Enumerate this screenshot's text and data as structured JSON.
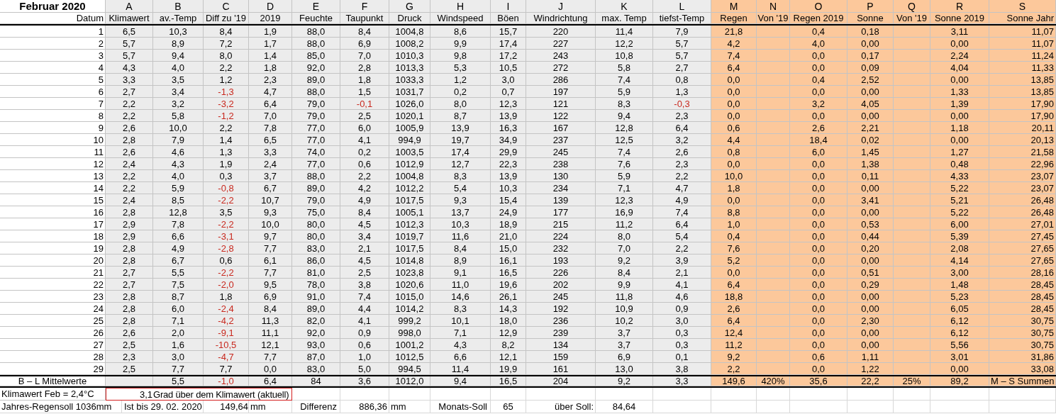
{
  "sheet": {
    "title": "Februar 2020",
    "column_letters": [
      "A",
      "B",
      "C",
      "D",
      "E",
      "F",
      "G",
      "H",
      "I",
      "J",
      "K",
      "L",
      "M",
      "N",
      "O",
      "P",
      "Q",
      "R",
      "S"
    ],
    "column_headers": [
      "Datum",
      "Klimawert",
      "av.-Temp",
      "Diff zu '19",
      "2019",
      "Feuchte",
      "Taupunkt",
      "Druck",
      "Windspeed",
      "Böen",
      "Windrichtung",
      "max. Temp",
      "tiefst-Temp",
      "Regen",
      "Von '19",
      "Regen 2019",
      "Sonne",
      "Von '19",
      "Sonne 2019",
      "Sonne Jahr"
    ],
    "rows": [
      [
        "1",
        "6,5",
        "10,3",
        "8,4",
        "1,9",
        "88,0",
        "8,4",
        "1004,8",
        "8,6",
        "15,7",
        "220",
        "11,4",
        "7,9",
        "21,8",
        null,
        "0,4",
        "0,18",
        null,
        "3,11",
        "11,07"
      ],
      [
        "2",
        "5,7",
        "8,9",
        "7,2",
        "1,7",
        "88,0",
        "6,9",
        "1008,2",
        "9,9",
        "17,4",
        "227",
        "12,2",
        "5,7",
        "4,2",
        null,
        "4,0",
        "0,00",
        null,
        "0,00",
        "11,07"
      ],
      [
        "3",
        "5,7",
        "9,4",
        "8,0",
        "1,4",
        "85,0",
        "7,0",
        "1010,3",
        "9,8",
        "17,2",
        "243",
        "10,8",
        "5,7",
        "7,4",
        null,
        "0,0",
        "0,17",
        null,
        "2,24",
        "11,24"
      ],
      [
        "4",
        "4,3",
        "4,0",
        "2,2",
        "1,8",
        "92,0",
        "2,8",
        "1013,3",
        "5,3",
        "10,5",
        "272",
        "5,8",
        "2,7",
        "6,4",
        null,
        "0,0",
        "0,09",
        null,
        "4,04",
        "11,33"
      ],
      [
        "5",
        "3,3",
        "3,5",
        "1,2",
        "2,3",
        "89,0",
        "1,8",
        "1033,3",
        "1,2",
        "3,0",
        "286",
        "7,4",
        "0,8",
        "0,0",
        null,
        "0,4",
        "2,52",
        null,
        "0,00",
        "13,85"
      ],
      [
        "6",
        "2,7",
        "3,4",
        "-1,3",
        "4,7",
        "88,0",
        "1,5",
        "1031,7",
        "0,2",
        "0,7",
        "197",
        "5,9",
        "1,3",
        "0,0",
        null,
        "0,0",
        "0,00",
        null,
        "1,33",
        "13,85"
      ],
      [
        "7",
        "2,2",
        "3,2",
        "-3,2",
        "6,4",
        "79,0",
        "-0,1",
        "1026,0",
        "8,0",
        "12,3",
        "121",
        "8,3",
        "-0,3",
        "0,0",
        null,
        "3,2",
        "4,05",
        null,
        "1,39",
        "17,90"
      ],
      [
        "8",
        "2,2",
        "5,8",
        "-1,2",
        "7,0",
        "79,0",
        "2,5",
        "1020,1",
        "8,7",
        "13,9",
        "122",
        "9,4",
        "2,3",
        "0,0",
        null,
        "0,0",
        "0,00",
        null,
        "0,00",
        "17,90"
      ],
      [
        "9",
        "2,6",
        "10,0",
        "2,2",
        "7,8",
        "77,0",
        "6,0",
        "1005,9",
        "13,9",
        "16,3",
        "167",
        "12,8",
        "6,4",
        "0,6",
        null,
        "2,6",
        "2,21",
        null,
        "1,18",
        "20,11"
      ],
      [
        "10",
        "2,8",
        "7,9",
        "1,4",
        "6,5",
        "77,0",
        "4,1",
        "994,9",
        "19,7",
        "34,9",
        "237",
        "12,5",
        "3,2",
        "4,4",
        null,
        "18,4",
        "0,02",
        null,
        "0,00",
        "20,13"
      ],
      [
        "11",
        "2,6",
        "4,6",
        "1,3",
        "3,3",
        "74,0",
        "0,2",
        "1003,5",
        "17,4",
        "29,9",
        "245",
        "7,4",
        "2,6",
        "0,8",
        null,
        "6,0",
        "1,45",
        null,
        "1,27",
        "21,58"
      ],
      [
        "12",
        "2,4",
        "4,3",
        "1,9",
        "2,4",
        "77,0",
        "0,6",
        "1012,9",
        "12,7",
        "22,3",
        "238",
        "7,6",
        "2,3",
        "0,0",
        null,
        "0,0",
        "1,38",
        null,
        "0,48",
        "22,96"
      ],
      [
        "13",
        "2,2",
        "4,0",
        "0,3",
        "3,7",
        "88,0",
        "2,2",
        "1004,8",
        "8,3",
        "13,9",
        "130",
        "5,9",
        "2,2",
        "10,0",
        null,
        "0,0",
        "0,11",
        null,
        "4,33",
        "23,07"
      ],
      [
        "14",
        "2,2",
        "5,9",
        "-0,8",
        "6,7",
        "89,0",
        "4,2",
        "1012,2",
        "5,4",
        "10,3",
        "234",
        "7,1",
        "4,7",
        "1,8",
        null,
        "0,0",
        "0,00",
        null,
        "5,22",
        "23,07"
      ],
      [
        "15",
        "2,4",
        "8,5",
        "-2,2",
        "10,7",
        "79,0",
        "4,9",
        "1017,5",
        "9,3",
        "15,4",
        "139",
        "12,3",
        "4,9",
        "0,0",
        null,
        "0,0",
        "3,41",
        null,
        "5,21",
        "26,48"
      ],
      [
        "16",
        "2,8",
        "12,8",
        "3,5",
        "9,3",
        "75,0",
        "8,4",
        "1005,1",
        "13,7",
        "24,9",
        "177",
        "16,9",
        "7,4",
        "8,8",
        null,
        "0,0",
        "0,00",
        null,
        "5,22",
        "26,48"
      ],
      [
        "17",
        "2,9",
        "7,8",
        "-2,2",
        "10,0",
        "80,0",
        "4,5",
        "1012,3",
        "10,3",
        "18,9",
        "215",
        "11,2",
        "6,4",
        "1,0",
        null,
        "0,0",
        "0,53",
        null,
        "6,00",
        "27,01"
      ],
      [
        "18",
        "2,9",
        "6,6",
        "-3,1",
        "9,7",
        "80,0",
        "3,4",
        "1019,7",
        "11,6",
        "21,0",
        "224",
        "8,0",
        "5,4",
        "0,4",
        null,
        "0,0",
        "0,44",
        null,
        "5,39",
        "27,45"
      ],
      [
        "19",
        "2,8",
        "4,9",
        "-2,8",
        "7,7",
        "83,0",
        "2,1",
        "1017,5",
        "8,4",
        "15,0",
        "232",
        "7,0",
        "2,2",
        "7,6",
        null,
        "0,0",
        "0,20",
        null,
        "2,08",
        "27,65"
      ],
      [
        "20",
        "2,8",
        "6,7",
        "0,6",
        "6,1",
        "86,0",
        "4,5",
        "1014,8",
        "8,9",
        "16,1",
        "193",
        "9,2",
        "3,9",
        "5,2",
        null,
        "0,0",
        "0,00",
        null,
        "4,14",
        "27,65"
      ],
      [
        "21",
        "2,7",
        "5,5",
        "-2,2",
        "7,7",
        "81,0",
        "2,5",
        "1023,8",
        "9,1",
        "16,5",
        "226",
        "8,4",
        "2,1",
        "0,0",
        null,
        "0,0",
        "0,51",
        null,
        "3,00",
        "28,16"
      ],
      [
        "22",
        "2,7",
        "7,5",
        "-2,0",
        "9,5",
        "78,0",
        "3,8",
        "1020,6",
        "11,0",
        "19,6",
        "202",
        "9,9",
        "4,1",
        "6,4",
        null,
        "0,0",
        "0,29",
        null,
        "1,48",
        "28,45"
      ],
      [
        "23",
        "2,8",
        "8,7",
        "1,8",
        "6,9",
        "91,0",
        "7,4",
        "1015,0",
        "14,6",
        "26,1",
        "245",
        "11,8",
        "4,6",
        "18,8",
        null,
        "0,0",
        "0,00",
        null,
        "5,23",
        "28,45"
      ],
      [
        "24",
        "2,8",
        "6,0",
        "-2,4",
        "8,4",
        "89,0",
        "4,4",
        "1014,2",
        "8,3",
        "14,3",
        "192",
        "10,9",
        "0,9",
        "2,6",
        null,
        "0,0",
        "0,00",
        null,
        "6,05",
        "28,45"
      ],
      [
        "25",
        "2,8",
        "7,1",
        "-4,2",
        "11,3",
        "82,0",
        "4,1",
        "999,2",
        "10,1",
        "18,0",
        "236",
        "10,2",
        "3,0",
        "6,4",
        null,
        "0,0",
        "2,30",
        null,
        "6,12",
        "30,75"
      ],
      [
        "26",
        "2,6",
        "2,0",
        "-9,1",
        "11,1",
        "92,0",
        "0,9",
        "998,0",
        "7,1",
        "12,9",
        "239",
        "3,7",
        "0,3",
        "12,4",
        null,
        "0,0",
        "0,00",
        null,
        "6,12",
        "30,75"
      ],
      [
        "27",
        "2,5",
        "1,6",
        "-10,5",
        "12,1",
        "93,0",
        "0,6",
        "1001,2",
        "4,3",
        "8,2",
        "134",
        "3,7",
        "0,3",
        "11,2",
        null,
        "0,0",
        "0,00",
        null,
        "5,56",
        "30,75"
      ],
      [
        "28",
        "2,3",
        "3,0",
        "-4,7",
        "7,7",
        "87,0",
        "1,0",
        "1012,5",
        "6,6",
        "12,1",
        "159",
        "6,9",
        "0,1",
        "9,2",
        null,
        "0,6",
        "1,11",
        null,
        "3,01",
        "31,86"
      ],
      [
        "29",
        "2,5",
        "7,7",
        "7,7",
        "0,0",
        "83,0",
        "5,0",
        "994,5",
        "11,4",
        "19,9",
        "161",
        "13,0",
        "3,8",
        "2,2",
        null,
        "0,0",
        "1,22",
        null,
        "0,00",
        "33,08"
      ]
    ],
    "averages": [
      "B – L Mittelwerte",
      "5,5",
      "-1,0",
      "6,4",
      "84",
      "3,6",
      "1012,0",
      "9,4",
      "16,5",
      "204",
      "9,2",
      "3,3",
      "149,6",
      "420%",
      "35,6",
      "22,2",
      "25%",
      "89,2",
      "M – S Summen"
    ],
    "climate": {
      "label": "Klimawert Feb = 2,4°C",
      "value": "3,1",
      "note": "Grad über dem Klimawert (aktuell)"
    },
    "rain": {
      "target": "Jahres-Regensoll 1036mm",
      "actual_label": "Ist bis 29. 02. 2020",
      "actual_value": "149,64",
      "actual_unit": "mm",
      "difference_label": "Differenz",
      "difference_value": "886,36",
      "difference_unit": "mm",
      "monthly_label": "Monats-Soll",
      "monthly_value": "65",
      "over_label": "über Soll:",
      "over_value": "84,64"
    }
  }
}
